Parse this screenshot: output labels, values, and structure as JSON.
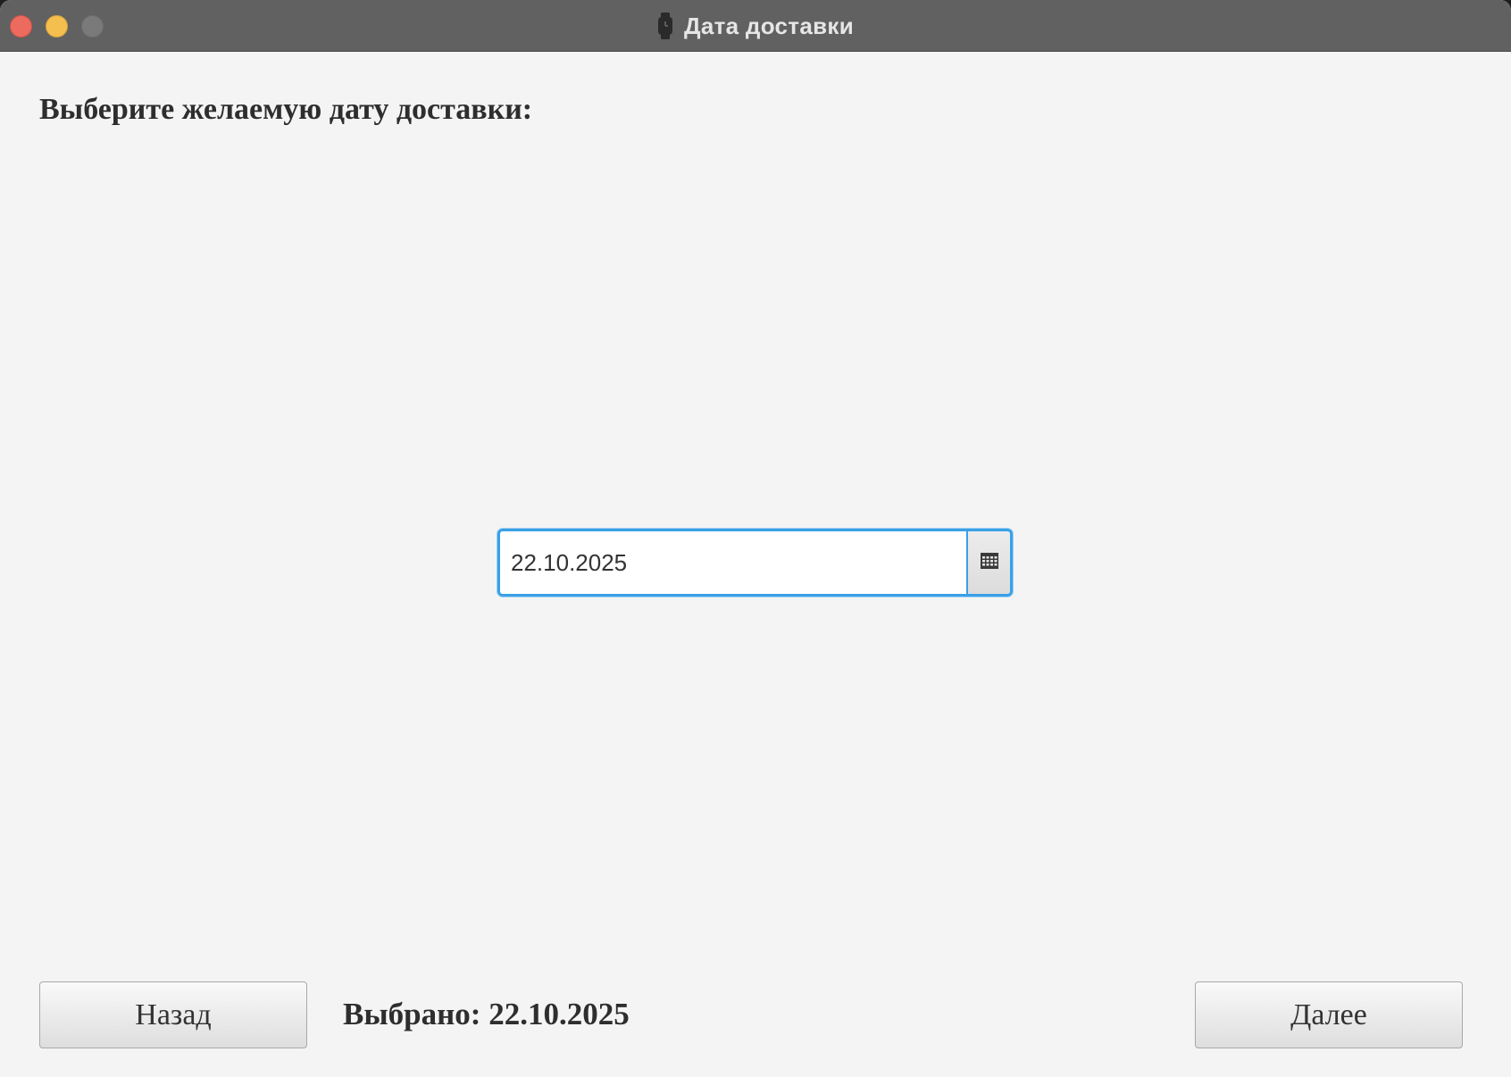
{
  "window": {
    "title": "Дата доставки",
    "title_icon": "watch-icon",
    "controls": [
      "close-button",
      "minimize-button",
      "zoom-button"
    ]
  },
  "main": {
    "prompt": "Выберите желаемую дату доставки:",
    "date_picker": {
      "value": "22.10.2025",
      "calendar_icon": "calendar-icon"
    }
  },
  "footer": {
    "back_label": "Назад",
    "selected_text": "Выбрано: 22.10.2025",
    "next_label": "Далее"
  },
  "colors": {
    "focus_ring": "#3aa0e6",
    "titlebar": "#616161",
    "close": "#ed6a5e",
    "minimize": "#f4bf4f",
    "zoom_disabled": "#7a7a7a",
    "background": "#f4f4f4"
  }
}
